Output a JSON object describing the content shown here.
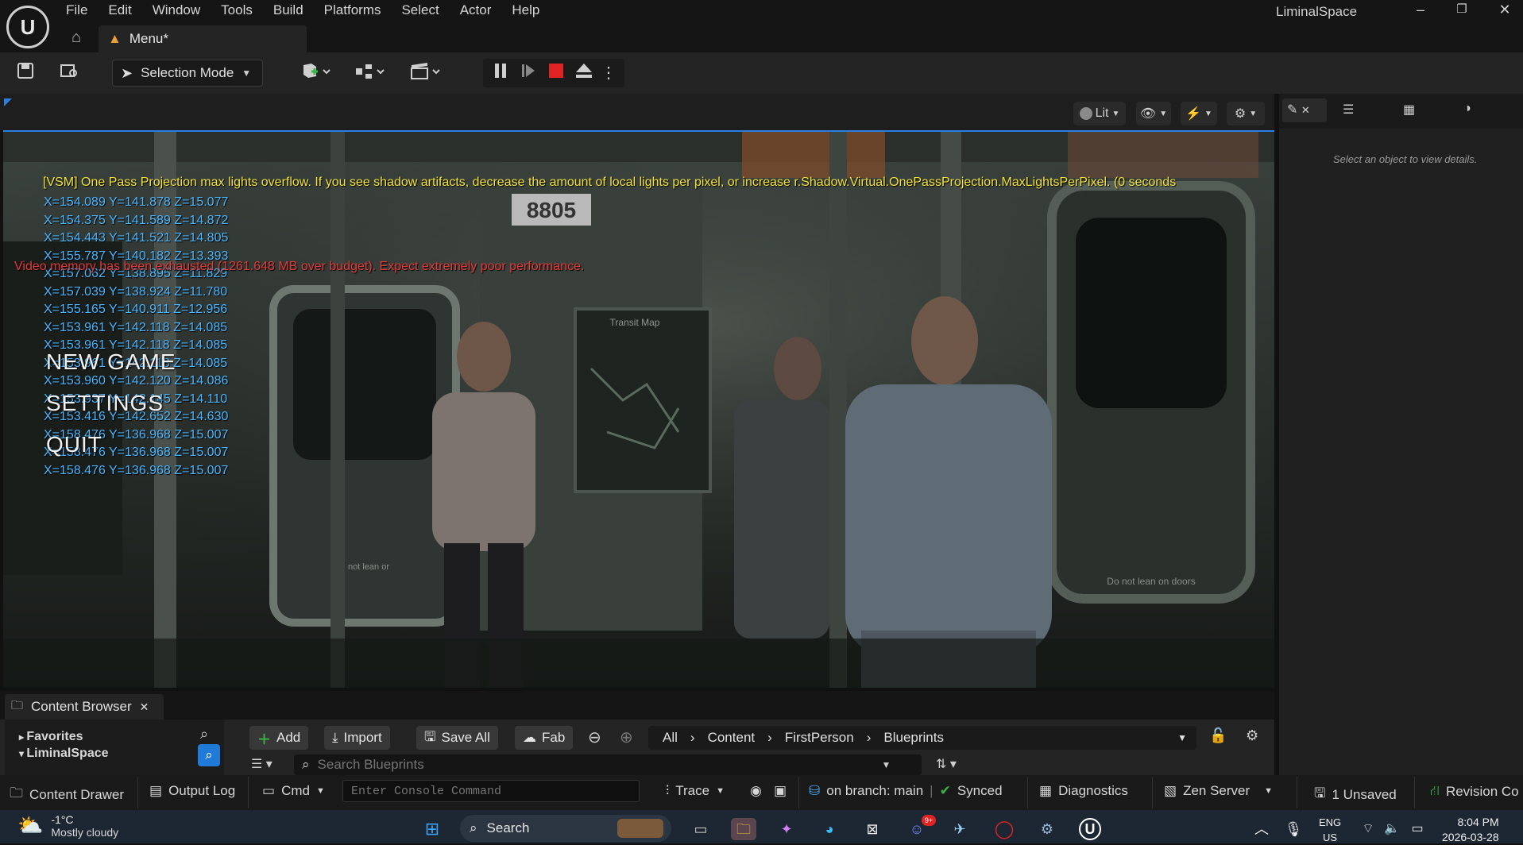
{
  "app": {
    "title": "LiminalSpace",
    "logo": "unreal-logo",
    "menu": [
      "File",
      "Edit",
      "Window",
      "Tools",
      "Build",
      "Platforms",
      "Select",
      "Actor",
      "Help"
    ],
    "level_tab": "Menu*"
  },
  "toolbar": {
    "selection_mode": "Selection Mode"
  },
  "viewport": {
    "lit_label": "Lit",
    "vsm_warning": "[VSM] One Pass Projection max lights overflow. If you see shadow artifacts, decrease the amount of local lights per pixel, or increase r.Shadow.Virtual.OnePassProjection.MaxLightsPerPixel. (0 seconds",
    "vram_warning": "Video memory has been exhausted (1261.648 MB over budget). Expect extremely poor performance.",
    "coords": [
      "X=154.089 Y=141.878 Z=15.077",
      "X=154.375 Y=141.589 Z=14.872",
      "X=154.443 Y=141.521 Z=14.805",
      "X=155.787 Y=140.182 Z=13.393",
      "X=157.062 Y=138.895 Z=11.829",
      "X=157.039 Y=138.924 Z=11.780",
      "X=155.165 Y=140.911 Z=12.956",
      "X=153.961 Y=142.118 Z=14.085",
      "X=153.961 Y=142.118 Z=14.085",
      "X=153.961 Y=142.118 Z=14.085",
      "X=153.960 Y=142.120 Z=14.086",
      "X=153.937 Y=142.145 Z=14.110",
      "X=153.416 Y=142.652 Z=14.630",
      "X=158.476 Y=136.968 Z=15.007",
      "X=158.476 Y=136.968 Z=15.007",
      "X=158.476 Y=136.968 Z=15.007"
    ],
    "game_menu": [
      "NEW GAME",
      "SETTINGS",
      "QUIT"
    ],
    "train_number": "8805",
    "transit_map": "Transit Map",
    "door_sign": "Do not lean on doors",
    "lean_sign": "not lean or"
  },
  "details": {
    "hint": "Select an object to view details."
  },
  "content_browser": {
    "tab": "Content Browser",
    "favorites": "Favorites",
    "project": "LiminalSpace",
    "add": "Add",
    "import": "Import",
    "save_all": "Save All",
    "fab": "Fab",
    "breadcrumb": [
      "All",
      "Content",
      "FirstPerson",
      "Blueprints"
    ],
    "search_placeholder": "Search Blueprints"
  },
  "statusbar": {
    "content_drawer": "Content Drawer",
    "output_log": "Output Log",
    "cmd": "Cmd",
    "console_placeholder": "Enter Console Command",
    "trace": "Trace",
    "branch": "on branch: main",
    "synced": "Synced",
    "diagnostics": "Diagnostics",
    "zen_server": "Zen Server",
    "unsaved": "1 Unsaved",
    "revision": "Revision Co"
  },
  "taskbar": {
    "temperature": "-1°C",
    "weather": "Mostly cloudy",
    "search": "Search",
    "language": "ENG",
    "region": "US",
    "time": "8:04 PM",
    "date": "2026-03-28",
    "discord_badge": "9+"
  },
  "colors": {
    "warning_yellow": "#f2e23a",
    "error_red": "#e43b3b",
    "coord_blue": "#49b6ff",
    "stop_red": "#e02424"
  }
}
